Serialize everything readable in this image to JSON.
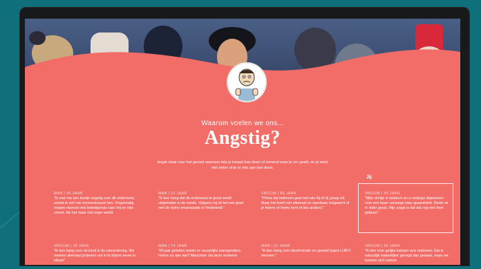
{
  "page": {
    "subtitle": "Waarom voelen we ons...",
    "title": "Angstig?",
    "intro": "Angst staat voor het gevoel wanneer iets je kwaad kan doen of iemand waar je om geeft, en je weet niet zeker of je er iets aan kan doen."
  },
  "icons": {
    "avatar": "scared-cartoon-face-icon"
  },
  "colors": {
    "accent": "#f26d68",
    "background": "#0f6f7a",
    "laptop_frame": "#17191b",
    "text": "#ffffff"
  },
  "jij": {
    "label": "Jij"
  },
  "cards": [
    {
      "meta": "MAN | 45 JAAR",
      "quote": "\"Ik voel me een beetje angstig over dit onderwerp, omdat ik zelf ook homoseksueel ben. Regelmatig roepen mensen iets beledigends naar mij en mijn vriend. Als het maar niet erger wordt."
    },
    {
      "meta": "MAN | 22 JAAR",
      "quote": "\"Ik ben bang dat dit onderwerp te groot wordt uitgemeten in de media. Volgens mij zit het wel goed met de homo emancipatie in Nederland.\""
    },
    {
      "meta": "VROUW | 66 JAAR",
      "quote": "\"Prima dat iedereen gaat met wie hij of zij graag wil. Maar het hoeft niet allemaal zo openbaar (ongeacht of je hetero of homo bent of iets anders).\""
    },
    {
      "meta": "VROUW | 43 JAAR",
      "quote": "\"Mijn nichtje is lesbisch en is onlangs afgewezen voor een baan vanwege haar geaardheid. Denkt ze in ieder geval. Mijn angst is dat dat nog een keer gebeurt.\""
    },
    {
      "meta": "VROUW | 18 JAAR",
      "quote": "\"Ik ben bang voor de kloof in de samenleving. We moeten allemaal proberen om in te blijven leven in elkaar\""
    },
    {
      "meta": "MAN | 74 JAAR",
      "quote": "\"50 jaar geleden waren er nauwelijks transgenders. Hoezo nu dan wel? Misschien dat deze moderne"
    },
    {
      "meta": "MAN | 31 JAAR",
      "quote": "\"Ik ben bang voor discriminatie en geweld tegen LHBTI mensen.\""
    },
    {
      "meta": "VROUW | 55 JAAR",
      "quote": "\"Ik ben voor gelijke kansen voor iedereen. Dat is natuurlijk makkelijker gezegd dan gedaan, maar we kunnen toch samen"
    }
  ]
}
